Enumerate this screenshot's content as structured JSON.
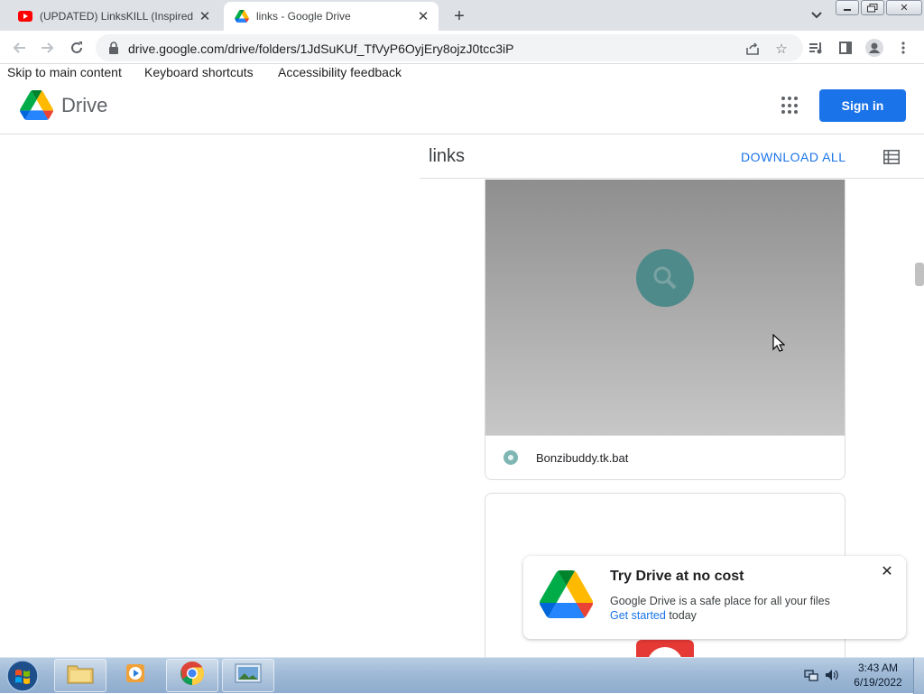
{
  "browser": {
    "tabs": [
      {
        "title": "(UPDATED) LinksKILL (Inspired By",
        "icon": "youtube-icon",
        "active": false
      },
      {
        "title": "links - Google Drive",
        "icon": "google-drive-icon",
        "active": true
      }
    ],
    "url": "drive.google.com/drive/folders/1JdSuKUf_TfVyP6OyjEry8ojzJ0tcc3iP"
  },
  "skip_links": {
    "skip": "Skip to main content",
    "shortcuts": "Keyboard shortcuts",
    "feedback": "Accessibility feedback"
  },
  "header": {
    "product": "Drive",
    "sign_in": "Sign in"
  },
  "folder": {
    "title": "links",
    "download_all": "DOWNLOAD ALL"
  },
  "files": [
    {
      "name": "Bonzibuddy.tk.bat"
    }
  ],
  "promo": {
    "title": "Try Drive at no cost",
    "line1": "Google Drive is a safe place for all your files",
    "link": "Get started",
    "tail": " today"
  },
  "taskbar": {
    "time": "3:43 AM",
    "date": "6/19/2022"
  },
  "colors": {
    "accent": "#1a73e8",
    "thumbnail_circle": "#4f8a8b"
  }
}
